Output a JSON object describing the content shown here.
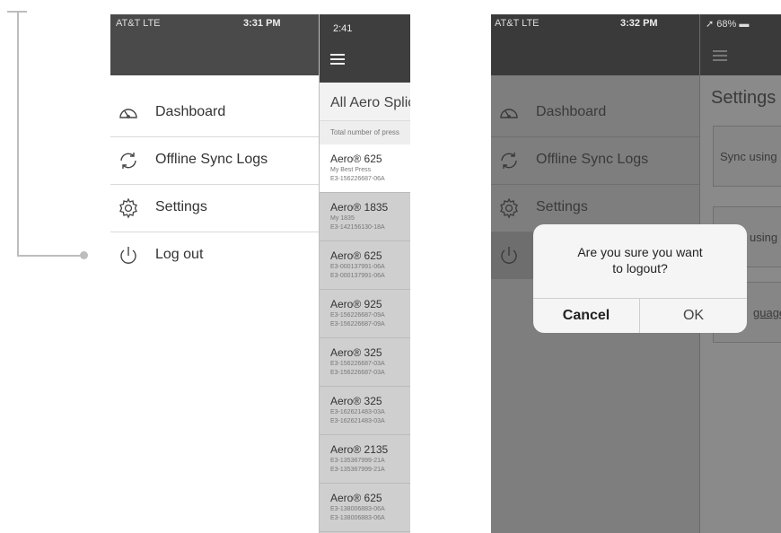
{
  "phone_left": {
    "status": {
      "carrier": "AT&T  LTE",
      "time": "3:31 PM"
    },
    "menu": [
      {
        "icon": "dashboard-icon",
        "label": "Dashboard"
      },
      {
        "icon": "sync-icon",
        "label": "Offline Sync Logs"
      },
      {
        "icon": "gear-icon",
        "label": "Settings"
      },
      {
        "icon": "power-icon",
        "label": "Log out"
      }
    ],
    "list_panel": {
      "time": "2:41",
      "title": "All Aero Splic",
      "subtitle": "Total number of press",
      "rows": [
        {
          "name": "Aero® 625",
          "line2": "My Best Press",
          "line3": "E3-156226687-06A"
        },
        {
          "name": "Aero® 1835",
          "line2": "My 1835",
          "line3": "E3-142156130-18A"
        },
        {
          "name": "Aero® 625",
          "line2": "E3-000137991-06A",
          "line3": "E3-000137991-06A"
        },
        {
          "name": "Aero® 925",
          "line2": "E3-156226687-09A",
          "line3": "E3-156226687-09A"
        },
        {
          "name": "Aero® 325",
          "line2": "E3-156226687-03A",
          "line3": "E3-156226687-03A"
        },
        {
          "name": "Aero® 325",
          "line2": "E3-162621483-03A",
          "line3": "E3-162621483-03A"
        },
        {
          "name": "Aero® 2135",
          "line2": "E3-135367999-21A",
          "line3": "E3-135367999-21A"
        },
        {
          "name": "Aero® 625",
          "line2": "E3-138006883-06A",
          "line3": "E3-138006883-06A"
        }
      ]
    }
  },
  "phone_right": {
    "status": {
      "carrier": "AT&T  LTE",
      "time": "3:32 PM",
      "battery": "68%"
    },
    "menu": [
      {
        "icon": "dashboard-icon",
        "label": "Dashboard"
      },
      {
        "icon": "sync-icon",
        "label": "Offline Sync Logs"
      },
      {
        "icon": "gear-icon",
        "label": "Settings"
      }
    ],
    "settings_panel": {
      "title": "Settings",
      "cards": [
        "Sync using",
        "using",
        "guage"
      ]
    },
    "dialog": {
      "message_line1": "Are you sure you want",
      "message_line2": "to logout?",
      "cancel_label": "Cancel",
      "ok_label": "OK"
    }
  }
}
